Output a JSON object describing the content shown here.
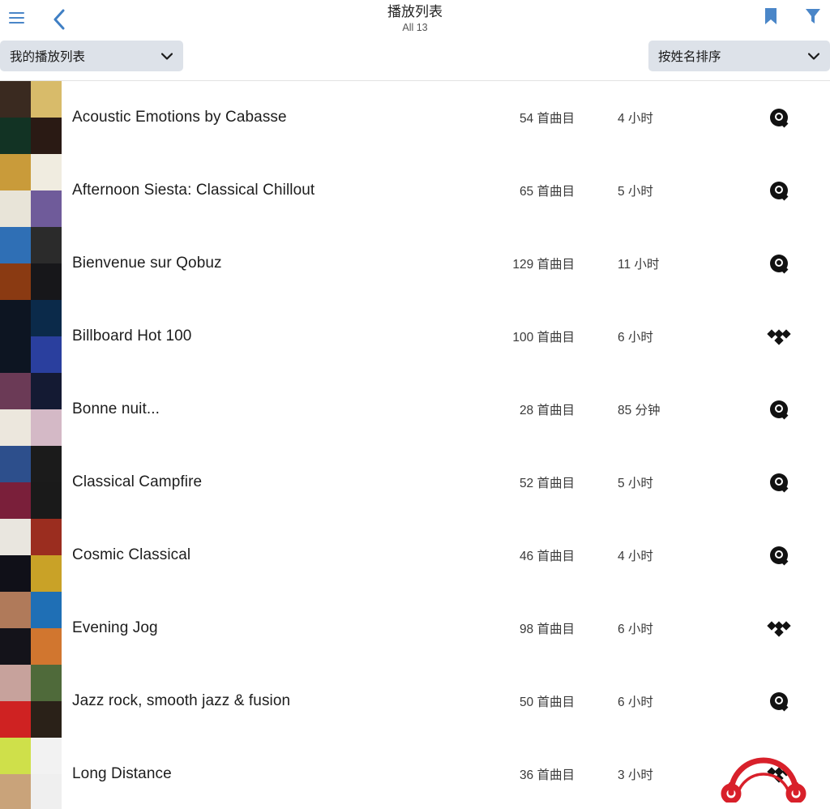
{
  "header": {
    "menu_icon": "hamburger-menu-icon",
    "back_icon": "chevron-left-icon",
    "title": "播放列表",
    "subtitle": "All 13",
    "bookmark_icon": "bookmark-icon",
    "filter_icon": "funnel-filter-icon",
    "accent_color": "#4a86c8"
  },
  "controls": {
    "source_select": {
      "value": "我的播放列表",
      "caret_icon": "chevron-down-icon"
    },
    "sort_select": {
      "value": "按姓名排序",
      "caret_icon": "chevron-down-icon"
    },
    "background": "#dde2e9"
  },
  "cursor": {
    "icon": "headphone-cursor-icon",
    "color": "#d8202a"
  },
  "list": {
    "count_unit": "首曲目",
    "rows": [
      {
        "title": "Acoustic Emotions by Cabasse",
        "tracks": "54 首曲目",
        "duration": "4 小时",
        "service": "qobuz",
        "thumb": [
          "#3a2a20",
          "#d8bb6a",
          "#123324",
          "#2a1a14"
        ]
      },
      {
        "title": "Afternoon Siesta: Classical Chillout",
        "tracks": "65 首曲目",
        "duration": "5 小时",
        "service": "qobuz",
        "thumb": [
          "#c99b3a",
          "#f0ece0",
          "#e8e4d8",
          "#6f5b9a"
        ]
      },
      {
        "title": "Bienvenue sur Qobuz",
        "tracks": "129 首曲目",
        "duration": "11 小时",
        "service": "qobuz",
        "thumb": [
          "#2f6fb5",
          "#2b2b2b",
          "#8a3a12",
          "#17171a"
        ]
      },
      {
        "title": "Billboard Hot 100",
        "tracks": "100 首曲目",
        "duration": "6 小时",
        "service": "tidal",
        "thumb": [
          "#0d1522",
          "#0b2a4a",
          "#0d1522",
          "#2a3f9e"
        ]
      },
      {
        "title": "Bonne nuit...",
        "tracks": "28 首曲目",
        "duration": "85 分钟",
        "service": "qobuz",
        "thumb": [
          "#6b3a56",
          "#141a33",
          "#ece7dd",
          "#d4b9c6"
        ]
      },
      {
        "title": "Classical Campfire",
        "tracks": "52 首曲目",
        "duration": "5 小时",
        "service": "qobuz",
        "thumb": [
          "#2d4f8c",
          "#1b1b1b",
          "#7a1f3a",
          "#1a1a1a"
        ]
      },
      {
        "title": "Cosmic Classical",
        "tracks": "46 首曲目",
        "duration": "4 小时",
        "service": "qobuz",
        "thumb": [
          "#e9e6df",
          "#9b2d1f",
          "#101018",
          "#c9a227"
        ]
      },
      {
        "title": "Evening Jog",
        "tracks": "98 首曲目",
        "duration": "6 小时",
        "service": "tidal",
        "thumb": [
          "#b07a5a",
          "#1f6fb5",
          "#14131a",
          "#d1762f"
        ]
      },
      {
        "title": "Jazz rock, smooth jazz & fusion",
        "tracks": "50 首曲目",
        "duration": "6 小时",
        "service": "qobuz",
        "thumb": [
          "#c7a29c",
          "#4f6a3a",
          "#cf2222",
          "#2a2118"
        ]
      },
      {
        "title": "Long Distance",
        "tracks": "36 首曲目",
        "duration": "3 小时",
        "service": "tidal",
        "thumb": [
          "#cfe04a",
          "#f2f2f2",
          "#c9a37a",
          "#efefef"
        ]
      }
    ]
  }
}
